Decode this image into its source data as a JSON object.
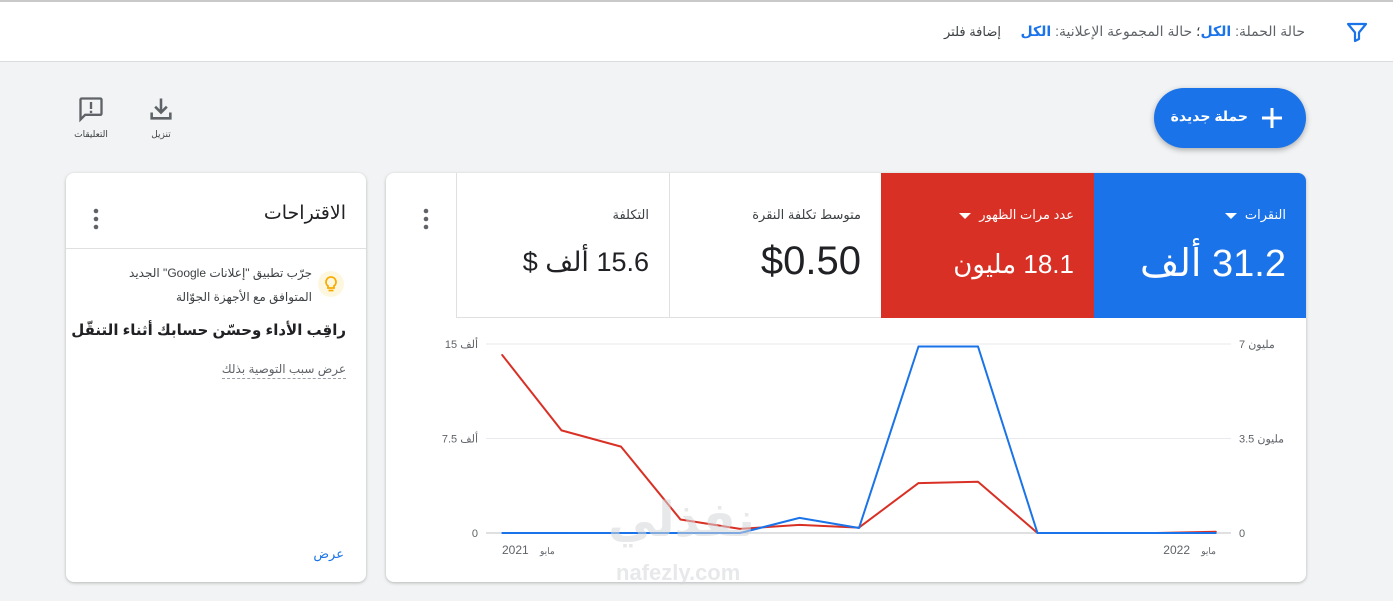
{
  "filters": {
    "campaign_status_label": "حالة الحملة:",
    "campaign_status_value": "الكل",
    "separator": "؛",
    "adgroup_status_label": "حالة المجموعة الإعلانية:",
    "adgroup_status_value": "الكل",
    "add_filter": "إضافة فلتر"
  },
  "actions": {
    "new_campaign": "حملة جديدة",
    "download": "تنزيل",
    "feedback": "التعليقات"
  },
  "metrics": {
    "clicks": {
      "label": "النقرات",
      "value": "31.2 ألف",
      "color": "#1a73e8"
    },
    "impressions": {
      "label": "عدد مرات الظهور",
      "value": "18.1 مليون",
      "color": "#d93025"
    },
    "avg_cpc": {
      "label": "متوسط تكلفة النقرة",
      "value": "$0.50"
    },
    "cost": {
      "label": "التكلفة",
      "value": "15.6 ألف $"
    }
  },
  "suggestions": {
    "title": "الاقتراحات",
    "text": "جرّب تطبيق \"إعلانات Google\" الجديد المتوافق مع الأجهزة الجوّالة",
    "headline": "راقِب الأداء وحسّن حسابك أثناء التنقّل",
    "why": "عرض سبب التوصية بذلك",
    "view": "عرض"
  },
  "watermark": {
    "line1": "نفذلي",
    "line2": "nafezly.com"
  },
  "chart_data": {
    "type": "line",
    "x": [
      "مايو 2021",
      "",
      "",
      "",
      "",
      "",
      "",
      "",
      "",
      "",
      "",
      "",
      "مايو 2022"
    ],
    "x_tick_labels": {
      "start": "2021",
      "start_prefix": "مايو",
      "end": "2022",
      "end_prefix": "مايو"
    },
    "left_axis": {
      "ticks": [
        "15 ألف",
        "7.5 ألف",
        "0"
      ],
      "ylim": [
        0,
        15
      ]
    },
    "right_axis": {
      "ticks": [
        "7 مليون",
        "3.5 مليون",
        "0"
      ],
      "ylim": [
        0,
        7
      ]
    },
    "series": [
      {
        "name": "النقرات",
        "axis": "left",
        "color": "#1a73e8",
        "values": [
          0,
          0,
          0,
          0,
          0,
          1.2,
          0.4,
          14.8,
          14.8,
          0,
          0,
          0,
          0
        ]
      },
      {
        "name": "عدد مرات الظهور",
        "axis": "right",
        "color": "#d93025",
        "values": [
          6.6,
          3.8,
          3.2,
          0.5,
          0.15,
          0.3,
          0.2,
          1.85,
          1.9,
          0,
          0,
          0,
          0.05
        ]
      }
    ],
    "grid": true
  }
}
